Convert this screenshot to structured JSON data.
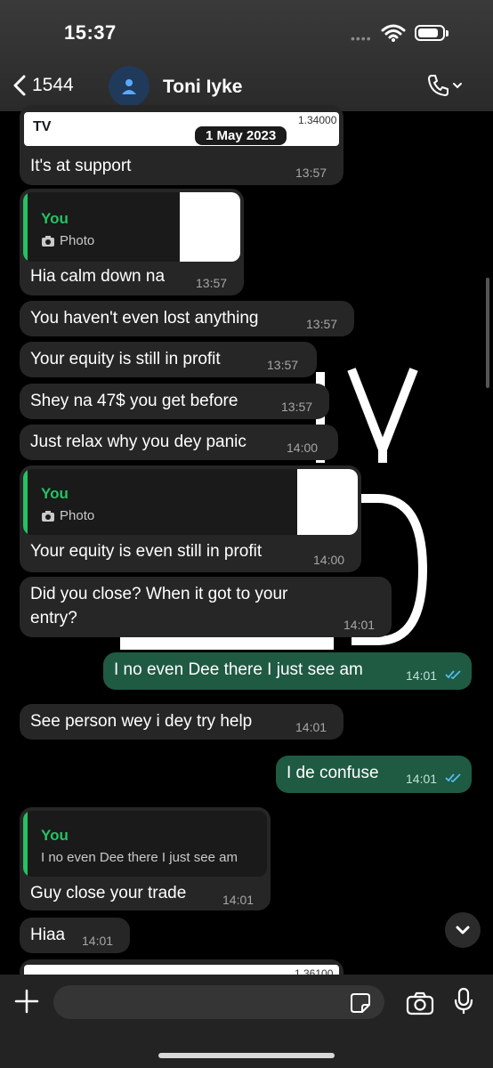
{
  "status_bar": {
    "time": "15:37"
  },
  "header": {
    "back_count": "1544",
    "contact_name": "Toni Iyke"
  },
  "chart_preview_top": {
    "price_label": "1.34000",
    "tv_logo": "TV"
  },
  "date_chip": "1 May 2023",
  "messages": [
    {
      "dir": "in",
      "text": "It's at support",
      "time": "13:57"
    },
    {
      "dir": "in",
      "quote_name": "You",
      "quote_text": "Photo",
      "text": "Hia calm down na",
      "time": "13:57"
    },
    {
      "dir": "in",
      "text": "You haven't even lost anything",
      "time": "13:57"
    },
    {
      "dir": "in",
      "text": "Your equity is still in profit",
      "time": "13:57"
    },
    {
      "dir": "in",
      "text": "Shey na 47$ you get before",
      "time": "13:57"
    },
    {
      "dir": "in",
      "text": "Just relax why you dey panic",
      "time": "14:00"
    },
    {
      "dir": "in",
      "quote_name": "You",
      "quote_text": "Photo",
      "text": "Your equity is even still in profit",
      "time": "14:00"
    },
    {
      "dir": "in",
      "text_line1": "Did you close? When it got to your",
      "text_line2": "entry?",
      "time": "14:01"
    },
    {
      "dir": "out",
      "text": "I no even Dee there I just see am",
      "time": "14:01"
    },
    {
      "dir": "in",
      "text": "See person wey i dey try help",
      "time": "14:01"
    },
    {
      "dir": "out",
      "text": "I de confuse",
      "time": "14:01"
    },
    {
      "dir": "in",
      "quote_name": "You",
      "quote_text": "I no even Dee there I just see am",
      "text": "Guy close your trade",
      "time": "14:01"
    },
    {
      "dir": "in",
      "text": "Hiaa",
      "time": "14:01"
    }
  ],
  "chart_preview_bottom": {
    "price_label": "1.36100"
  },
  "composer": {
    "placeholder": ""
  },
  "colors": {
    "incoming_bubble": "#262626",
    "outgoing_bubble": "#1f5a43",
    "quote_accent": "#25c163",
    "read_ticks": "#53bdeb"
  },
  "icons": [
    "back-chevron-icon",
    "person-icon",
    "phone-icon",
    "chevron-down-icon",
    "plus-icon",
    "sticker-icon",
    "camera-icon",
    "mic-icon",
    "photo-icon",
    "double-check-icon",
    "wifi-icon",
    "battery-icon"
  ]
}
